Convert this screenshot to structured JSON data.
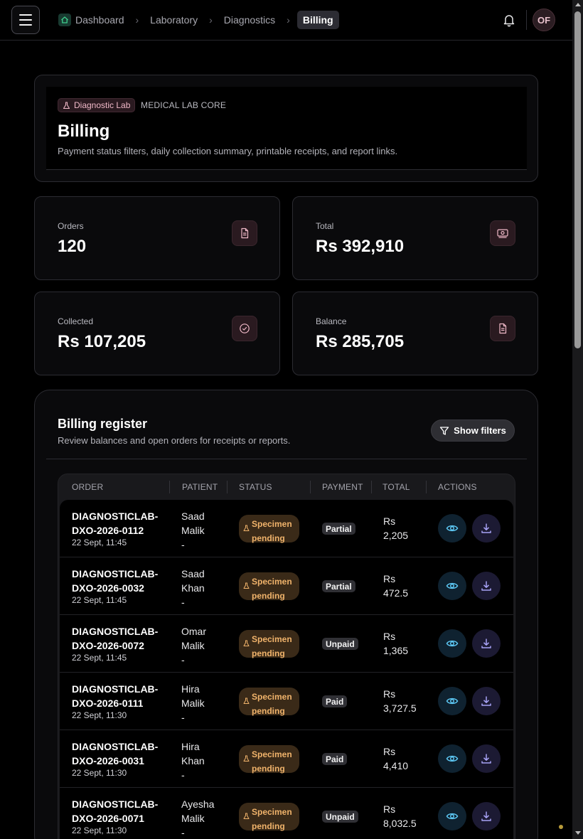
{
  "breadcrumb": {
    "items": [
      "Dashboard",
      "Laboratory",
      "Diagnostics",
      "Billing"
    ]
  },
  "user": {
    "initials": "OF"
  },
  "hero": {
    "badge": "Diagnostic Lab",
    "module": "MEDICAL LAB CORE",
    "title": "Billing",
    "subtitle": "Payment status filters, daily collection summary, printable receipts, and report links."
  },
  "stats": [
    {
      "label": "Orders",
      "value": "120",
      "icon": "document-icon"
    },
    {
      "label": "Total",
      "value": "Rs 392,910",
      "icon": "cash-icon"
    },
    {
      "label": "Collected",
      "value": "Rs 107,205",
      "icon": "check-circle-icon"
    },
    {
      "label": "Balance",
      "value": "Rs 285,705",
      "icon": "document-icon"
    }
  ],
  "register": {
    "title": "Billing register",
    "subtitle": "Review balances and open orders for receipts or reports.",
    "filter_label": "Show filters",
    "columns": [
      "ORDER",
      "PATIENT",
      "STATUS",
      "PAYMENT",
      "TOTAL",
      "ACTIONS"
    ],
    "rows": [
      {
        "order": "DIAGNOSTICLAB-DXO-2026-0112",
        "time": "22 Sept, 11:45",
        "patient": "Saad Malik",
        "patient_extra": "-",
        "status": "Specimen pending",
        "payment": "Partial",
        "total": "Rs 2,205"
      },
      {
        "order": "DIAGNOSTICLAB-DXO-2026-0032",
        "time": "22 Sept, 11:45",
        "patient": "Saad Khan",
        "patient_extra": "-",
        "status": "Specimen pending",
        "payment": "Partial",
        "total": "Rs 472.5"
      },
      {
        "order": "DIAGNOSTICLAB-DXO-2026-0072",
        "time": "22 Sept, 11:45",
        "patient": "Omar Malik",
        "patient_extra": "-",
        "status": "Specimen pending",
        "payment": "Unpaid",
        "total": "Rs 1,365"
      },
      {
        "order": "DIAGNOSTICLAB-DXO-2026-0111",
        "time": "22 Sept, 11:30",
        "patient": "Hira Malik",
        "patient_extra": "-",
        "status": "Specimen pending",
        "payment": "Paid",
        "total": "Rs 3,727.5"
      },
      {
        "order": "DIAGNOSTICLAB-DXO-2026-0031",
        "time": "22 Sept, 11:30",
        "patient": "Hira Khan",
        "patient_extra": "-",
        "status": "Specimen pending",
        "payment": "Paid",
        "total": "Rs 4,410"
      },
      {
        "order": "DIAGNOSTICLAB-DXO-2026-0071",
        "time": "22 Sept, 11:30",
        "patient": "Ayesha Malik",
        "patient_extra": "-",
        "status": "Specimen pending",
        "payment": "Unpaid",
        "total": "Rs 8,032.5"
      }
    ]
  },
  "colors": {
    "accent_pink": "#f0b9c8",
    "status_pending": "#f0b36b",
    "view_action": "#5cc6f2",
    "download_action": "#a7a2f5",
    "home_icon": "#3ecf8e"
  }
}
